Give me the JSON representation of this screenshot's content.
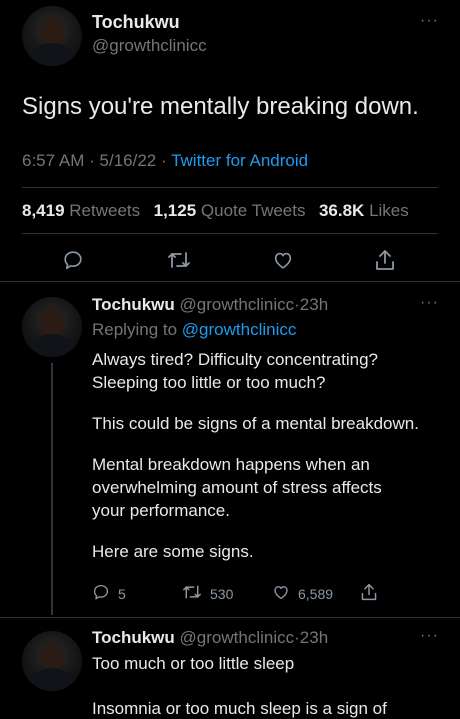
{
  "main_tweet": {
    "author_name": "Tochukwu",
    "handle": "@growthclinicc",
    "text": "Signs you're mentally breaking down.",
    "time": "6:57 AM",
    "date": "5/16/22",
    "client": "Twitter for Android",
    "separator": "·",
    "retweets_count": "8,419",
    "retweets_label": "Retweets",
    "quotes_count": "1,125",
    "quotes_label": "Quote Tweets",
    "likes_count": "36.8K",
    "likes_label": "Likes"
  },
  "reply1": {
    "author_name": "Tochukwu",
    "handle": "@growthclinicc",
    "age": "23h",
    "replying_prefix": "Replying to",
    "replying_handle": "@growthclinicc",
    "paragraphs": [
      "Always tired? Difficulty concentrating? Sleeping too little or too much?",
      "This could be signs of a mental breakdown.",
      "Mental breakdown happens when an overwhelming amount of stress affects your performance.",
      "Here are some signs."
    ],
    "replies": "5",
    "retweets": "530",
    "likes": "6,589"
  },
  "reply2": {
    "author_name": "Tochukwu",
    "handle": "@growthclinicc",
    "age": "23h",
    "line1": "Too much or too little sleep",
    "line2": "Insomnia or too much sleep is a sign of"
  },
  "icons": [
    "more-icon",
    "reply-icon",
    "retweet-icon",
    "like-icon",
    "share-icon"
  ],
  "colors": {
    "background": "#000000",
    "link": "#1d9bf0",
    "muted": "#71767b",
    "text": "#e7e9ea",
    "divider": "#2f3336"
  }
}
